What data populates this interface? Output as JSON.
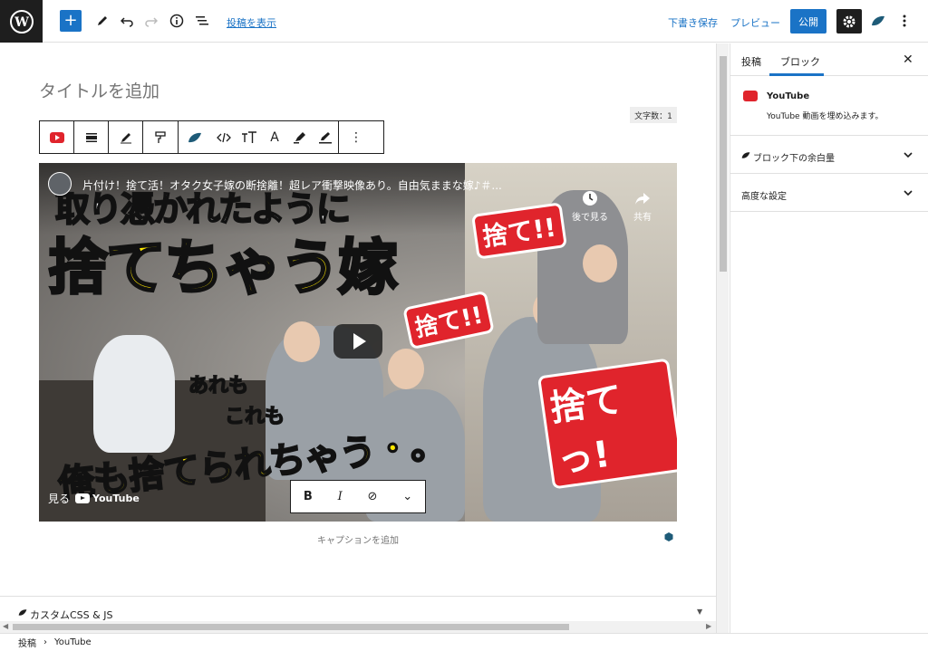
{
  "topbar": {
    "add_label": "+",
    "view_post": "投稿を表示",
    "save_draft": "下書き保存",
    "preview": "プレビュー",
    "publish": "公開"
  },
  "editor": {
    "title_placeholder": "タイトルを追加",
    "word_count": "文字数：1",
    "caption_placeholder": "キャプションを追加"
  },
  "block_toolbar": {
    "text_color_label": "A",
    "more_label": "⋮"
  },
  "video": {
    "title": "片付け！捨て活！オタク女子嫁の断捨離！超レア衝撃映像あり。自由気ままな嫁♪＃...",
    "watch_later": "後で見る",
    "share": "共有",
    "watch_on": "見る",
    "youtube": "YouTube",
    "thumb_top": "取り憑かれたように",
    "thumb_big": "捨てちゃう嫁",
    "thumb_bottom": "俺も捨てられちゃう・。",
    "sute1": "捨て!!",
    "sute2": "捨て!!",
    "sute3": "捨てっ!",
    "are": "あれも",
    "kore": "これも"
  },
  "format_toolbar": {
    "bold": "B",
    "italic": "I",
    "link": "⊘",
    "more": "⌄"
  },
  "custom_css": {
    "label": "カスタムCSS & JS"
  },
  "statusbar": {
    "crumb1": "投稿",
    "sep": "›",
    "crumb2": "YouTube"
  },
  "sidebar": {
    "tab_post": "投稿",
    "tab_block": "ブロック",
    "close": "✕",
    "block_name": "YouTube",
    "block_desc": "YouTube 動画を埋め込みます。",
    "panel1": "ブロック下の余白量",
    "panel2": "高度な設定"
  },
  "colors": {
    "accent": "#1a73c6",
    "dark": "#1e1e1e",
    "youtube_red": "#e0242c"
  }
}
